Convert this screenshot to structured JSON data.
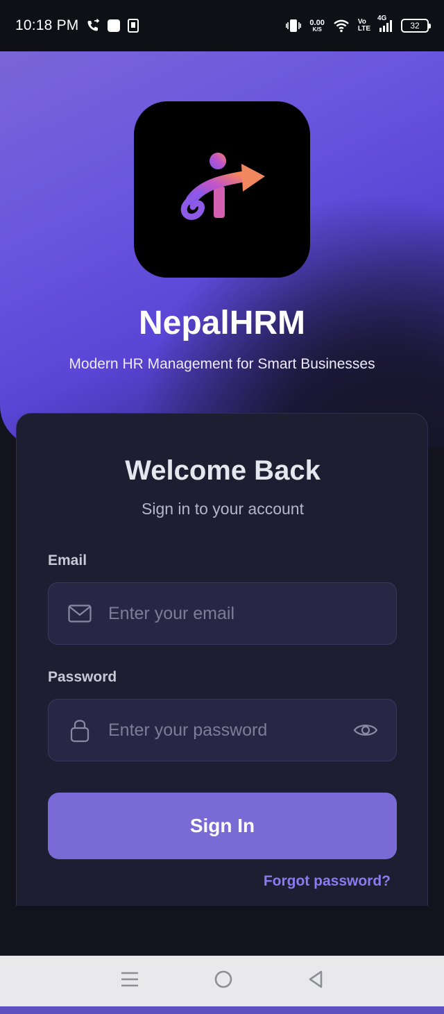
{
  "status_bar": {
    "time": "10:18 PM",
    "net_speed_value": "0.00",
    "net_speed_unit": "K/S",
    "volte_top": "Vo",
    "volte_bottom": "LTE",
    "network_type": "4G",
    "battery_level": "32",
    "icons": [
      "call-forward-icon",
      "notification-square-icon",
      "sim-icon",
      "vibrate-icon",
      "wifi-icon",
      "signal-icon",
      "battery-icon"
    ]
  },
  "hero": {
    "app_name": "NepalHRM",
    "tagline": "Modern HR Management for Smart Businesses",
    "logo_icon": "nepalhrm-logo",
    "gradient_colors": [
      "#7a66d8",
      "#5b45d6",
      "#1d1a3c"
    ]
  },
  "login_card": {
    "title": "Welcome Back",
    "subtitle": "Sign in to your account",
    "email": {
      "label": "Email",
      "placeholder": "Enter your email",
      "value": "",
      "icon": "mail-icon"
    },
    "password": {
      "label": "Password",
      "placeholder": "Enter your password",
      "value": "",
      "icon": "lock-icon",
      "toggle_icon": "eye-icon"
    },
    "sign_in_label": "Sign In",
    "forgot_password_label": "Forgot password?",
    "accent_color": "#7a6ad6",
    "link_color": "#8b7bf0"
  },
  "nav_bar": {
    "icons": [
      "menu-icon",
      "home-circle-icon",
      "back-triangle-icon"
    ]
  }
}
